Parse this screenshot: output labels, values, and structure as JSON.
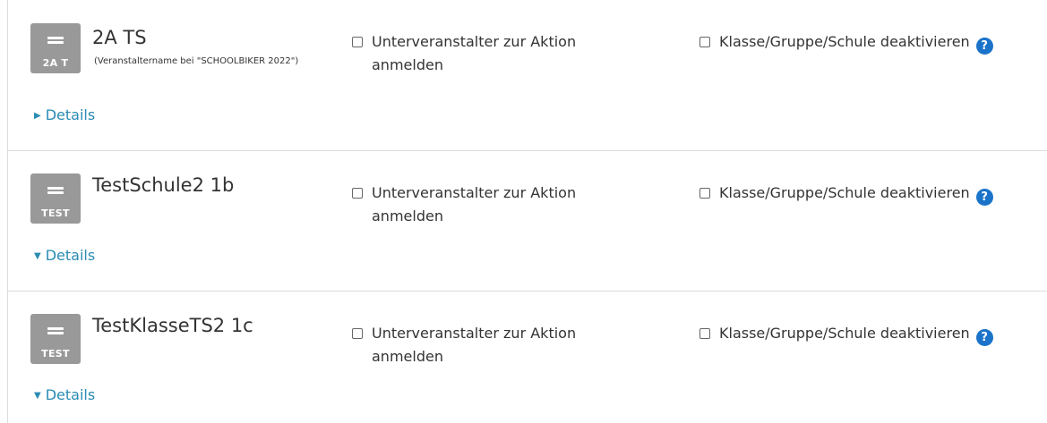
{
  "entries": [
    {
      "name": "2A TS",
      "subname": "(Veranstaltername bei \"SCHOOLBIKER 2022\")",
      "avatar_tag": "2A T",
      "option_register": "Unterveranstalter zur Aktion anmelden",
      "option_deactivate": "Klasse/Gruppe/Schule deaktivieren",
      "help_icon": "?",
      "details_toggle": "▶",
      "details_label": "Details"
    },
    {
      "name": "TestSchule2 1b",
      "subname": "",
      "avatar_tag": "TEST",
      "option_register": "Unterveranstalter zur Aktion anmelden",
      "option_deactivate": "Klasse/Gruppe/Schule deaktivieren",
      "help_icon": "?",
      "details_toggle": "▼",
      "details_label": "Details"
    },
    {
      "name": "TestKlasseTS2 1c",
      "subname": "",
      "avatar_tag": "TEST",
      "option_register": "Unterveranstalter zur Aktion anmelden",
      "option_deactivate": "Klasse/Gruppe/Schule deaktivieren",
      "help_icon": "?",
      "details_toggle": "▼",
      "details_label": "Details"
    }
  ],
  "colors": {
    "link": "#2a8bb3",
    "avatar_bg": "#999999",
    "help_icon_bg": "#1a73c9",
    "divider": "#dddddd"
  }
}
